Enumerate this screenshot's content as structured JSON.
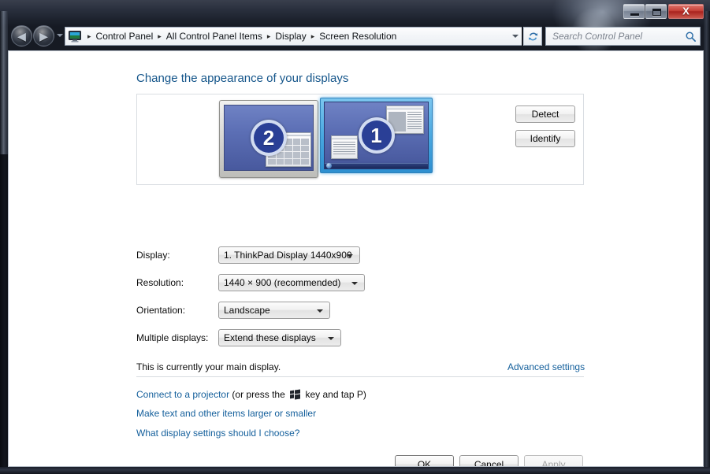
{
  "window": {
    "controls": {
      "minimize_label": "Minimize",
      "maximize_label": "Maximize",
      "close_label": "X"
    }
  },
  "navbar": {
    "back_arrow": "◀",
    "forward_arrow": "▶",
    "breadcrumb_icon": "display-icon",
    "breadcrumbs": [
      {
        "label": "Control Panel"
      },
      {
        "label": "All Control Panel Items"
      },
      {
        "label": "Display"
      },
      {
        "label": "Screen Resolution"
      }
    ],
    "separator_glyph": "▸",
    "refresh_icon": "refresh-icon",
    "search": {
      "placeholder": "Search Control Panel",
      "icon": "search-icon"
    }
  },
  "page": {
    "title": "Change the appearance of your displays"
  },
  "preview": {
    "monitors": [
      {
        "number": "2",
        "selected": false,
        "name": "monitor-2"
      },
      {
        "number": "1",
        "selected": true,
        "name": "monitor-1"
      }
    ],
    "detect_label": "Detect",
    "identify_label": "Identify"
  },
  "form": {
    "rows": [
      {
        "label": "Display:",
        "value": "1. ThinkPad Display 1440x900"
      },
      {
        "label": "Resolution:",
        "value": "1440 × 900 (recommended)"
      },
      {
        "label": "Orientation:",
        "value": "Landscape"
      },
      {
        "label": "Multiple displays:",
        "value": "Extend these displays"
      }
    ]
  },
  "status": {
    "text": "This is currently your main display.",
    "advanced_settings_label": "Advanced settings"
  },
  "links": {
    "projector_link": "Connect to a projector",
    "projector_before": "(or press the",
    "projector_after": "key and tap P)",
    "windows_key_icon": "windows-key-icon",
    "text_size": "Make text and other items larger or smaller",
    "what_settings": "What display settings should I choose?"
  },
  "dialog_buttons": {
    "ok": "OK",
    "cancel": "Cancel",
    "apply": "Apply",
    "apply_disabled": true
  },
  "colors": {
    "title_blue": "#14558a",
    "link_blue": "#15609c",
    "selected_monitor_glow": "#4aa8e0",
    "monitor_screen": "#5c6fb5",
    "badge_blue": "#2a3f96",
    "close_button_red": "#ce4238"
  }
}
